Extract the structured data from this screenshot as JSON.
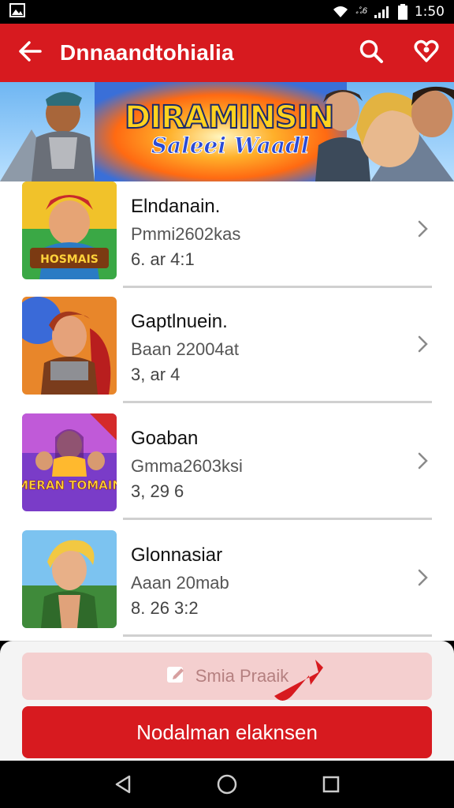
{
  "status_bar": {
    "time": "1:50",
    "network": "ஃ6"
  },
  "app_bar": {
    "title": "Dnnaandtohialia",
    "back_icon": "arrow-left-icon",
    "search_icon": "search-icon",
    "heart_icon": "heart-icon"
  },
  "banner": {
    "title": "DIRAMINSIN",
    "subtitle": "Saleei Waadl"
  },
  "list": {
    "items": [
      {
        "name": "Elndanain.",
        "sub": "Pmmi2602kas",
        "meta": "6. ar 4:1"
      },
      {
        "name": "Gaptlnuein.",
        "sub": "Baan 22004at",
        "meta": "3, ar 4"
      },
      {
        "name": "Goaban",
        "sub": "Gmma2603ksi",
        "meta": "3, 29 6",
        "thumb_text": "MERAN TOMAIN"
      },
      {
        "name": "Glonnasiar",
        "sub": "Aaan 20mab",
        "meta": "8. 26 3:2"
      }
    ],
    "first_thumb_text": "HOSMAIS"
  },
  "sheet": {
    "secondary_label": "Smia Praaik",
    "primary_label": "Nodalman elaknsen"
  },
  "colors": {
    "primary": "#d71a1f",
    "secondary_bg": "#f4cfcf"
  }
}
